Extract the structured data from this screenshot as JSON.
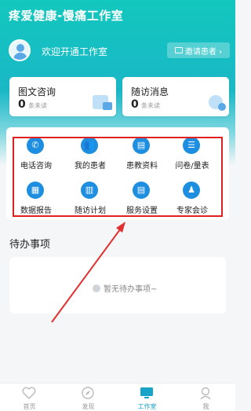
{
  "app": {
    "title": "疼爱健康-慢痛工作室"
  },
  "profile": {
    "welcome": "欢迎开通工作室",
    "invite_label": "邀请患者 ›"
  },
  "cards": [
    {
      "title": "图文咨询",
      "count": "0",
      "unit": "条未读"
    },
    {
      "title": "随访消息",
      "count": "0",
      "unit": "条未读"
    }
  ],
  "grid": {
    "items": [
      {
        "label": "电话咨询",
        "icon": "phone-icon",
        "glyph": "✆"
      },
      {
        "label": "我的患者",
        "icon": "patients-icon",
        "glyph": "👥"
      },
      {
        "label": "患教资料",
        "icon": "book-icon",
        "glyph": "▤"
      },
      {
        "label": "问卷/量表",
        "icon": "questionnaire-icon",
        "glyph": "☰"
      },
      {
        "label": "数据报告",
        "icon": "report-icon",
        "glyph": "▦"
      },
      {
        "label": "随访计划",
        "icon": "calendar-icon",
        "glyph": "▥"
      },
      {
        "label": "服务设置",
        "icon": "settings-doc-icon",
        "glyph": "▤"
      },
      {
        "label": "专家会诊",
        "icon": "expert-icon",
        "glyph": "♟"
      }
    ]
  },
  "todo": {
    "title": "待办事项",
    "empty_text": "暂无待办事项~"
  },
  "tabbar": {
    "items": [
      {
        "label": "首页",
        "icon": "home-heart-icon"
      },
      {
        "label": "发现",
        "icon": "compass-icon"
      },
      {
        "label": "工作室",
        "icon": "workstation-icon",
        "active": true
      },
      {
        "label": "我",
        "icon": "nurse-icon"
      }
    ]
  },
  "colors": {
    "accent": "#12c7bd",
    "icon_blue": "#1e8fe0",
    "highlight": "#e02020"
  }
}
